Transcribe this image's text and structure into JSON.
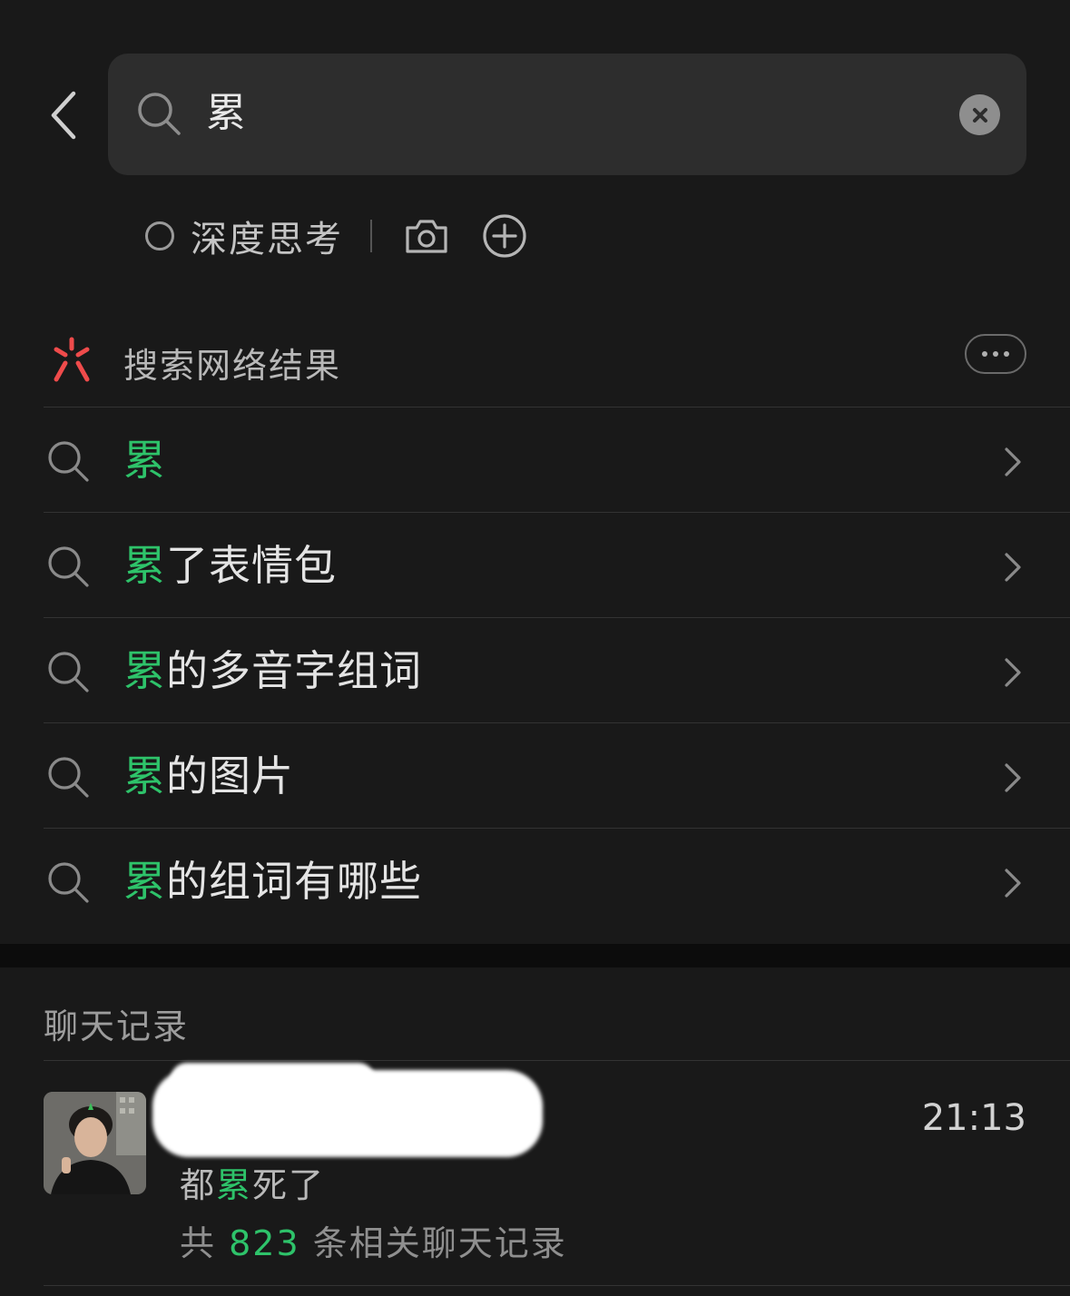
{
  "search": {
    "query": "累",
    "clear_icon": "close-circle-icon",
    "search_icon": "search-icon"
  },
  "options": {
    "deep_think_label": "深度思考",
    "camera_icon": "camera-icon",
    "add_icon": "plus-circle-icon"
  },
  "web_results": {
    "title": "搜索网络结果",
    "logo_icon": "asterisk-logo-icon",
    "more_icon": "more-dots-icon",
    "suggestions": [
      {
        "highlight": "累",
        "rest": ""
      },
      {
        "highlight": "累",
        "rest": "了表情包"
      },
      {
        "highlight": "累",
        "rest": "的多音字组词"
      },
      {
        "highlight": "累",
        "rest": "的图片"
      },
      {
        "highlight": "累",
        "rest": "的组词有哪些"
      }
    ]
  },
  "chat_records": {
    "title": "聊天记录",
    "items": [
      {
        "time": "21:13",
        "message_prefix": "都",
        "message_highlight": "累",
        "message_suffix": "死了",
        "count_prefix": "共 ",
        "count": "823",
        "count_suffix": " 条相关聊天记录"
      }
    ]
  },
  "colors": {
    "accent_green": "#2ec36a",
    "logo_red": "#ef4b4b",
    "background": "#191919"
  }
}
